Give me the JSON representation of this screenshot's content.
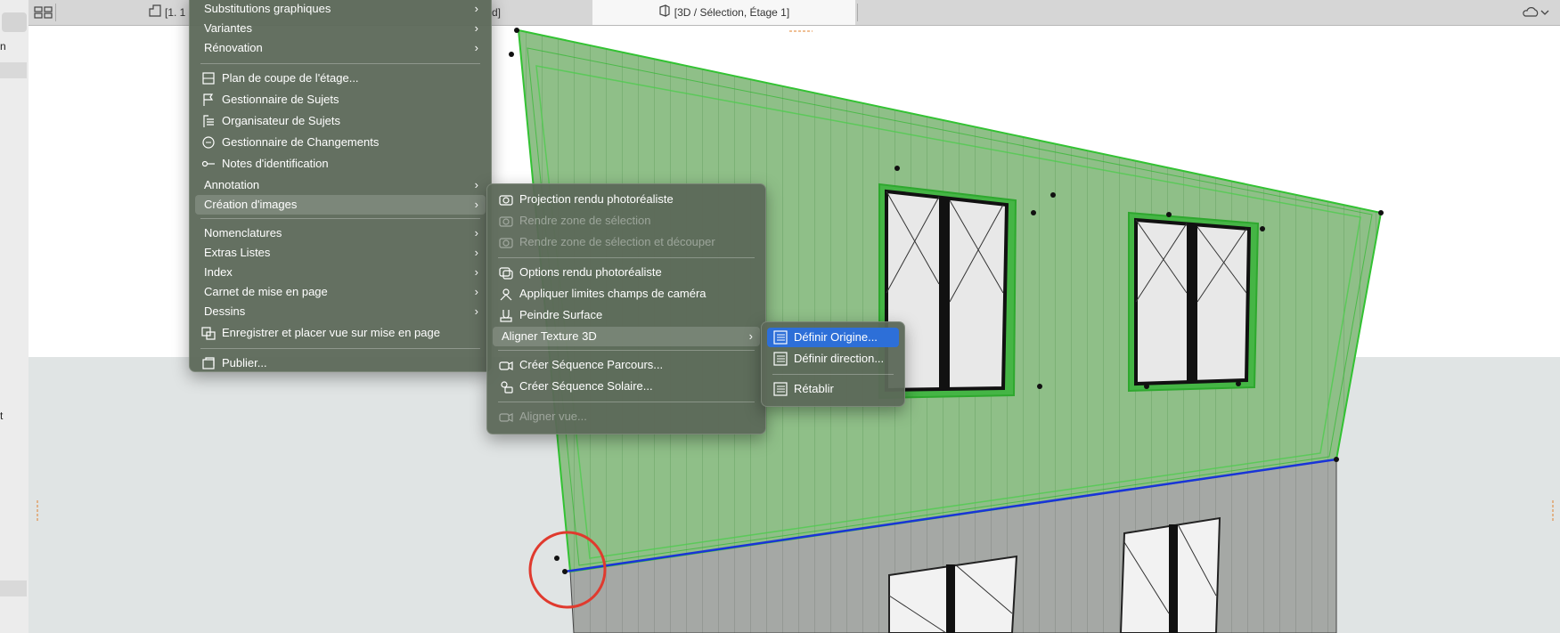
{
  "tabs": {
    "plan_label": "[1. 1",
    "plan_suffix": "d]",
    "active_label": "[3D / Sélection, Étage 1]"
  },
  "left_strip": {
    "items": [
      "n",
      "t"
    ]
  },
  "menu1": {
    "items": [
      {
        "label": "Substitutions graphiques",
        "sub": true
      },
      {
        "label": "Variantes",
        "sub": true
      },
      {
        "label": "Rénovation",
        "sub": true
      },
      {
        "label": "Plan de coupe de l'étage...",
        "icon": "floor-plan-cut-icon"
      },
      {
        "label": "Gestionnaire de Sujets",
        "icon": "flag-icon"
      },
      {
        "label": "Organisateur de Sujets",
        "icon": "organizer-icon"
      },
      {
        "label": "Gestionnaire de Changements",
        "icon": "changes-icon"
      },
      {
        "label": "Notes d'identification",
        "icon": "id-note-icon"
      },
      {
        "label": "Annotation",
        "sub": true
      },
      {
        "label": "Création d'images",
        "sub": true,
        "highlighted": true
      },
      {
        "label": "Nomenclatures",
        "sub": true
      },
      {
        "label": "Extras Listes",
        "sub": true
      },
      {
        "label": "Index",
        "sub": true
      },
      {
        "label": "Carnet de mise en page",
        "sub": true
      },
      {
        "label": "Dessins",
        "sub": true
      },
      {
        "label": "Enregistrer et placer vue sur mise en page",
        "icon": "save-place-icon"
      },
      {
        "label": "Publier...",
        "icon": "publish-icon"
      }
    ]
  },
  "menu2": {
    "items": [
      {
        "label": "Projection rendu photoréaliste",
        "icon": "camera-icon"
      },
      {
        "label": "Rendre zone de sélection",
        "icon": "camera-selection-icon",
        "disabled": true
      },
      {
        "label": "Rendre zone de sélection et découper",
        "icon": "camera-crop-icon",
        "disabled": true
      },
      {
        "label": "Options rendu photoréaliste",
        "icon": "render-options-icon"
      },
      {
        "label": "Appliquer limites champs de caméra",
        "icon": "camera-limits-icon"
      },
      {
        "label": "Peindre Surface",
        "icon": "paint-icon"
      },
      {
        "label": "Aligner Texture 3D",
        "sub": true,
        "highlighted": true
      },
      {
        "label": "Créer Séquence Parcours...",
        "icon": "walkthrough-icon"
      },
      {
        "label": "Créer Séquence Solaire...",
        "icon": "sun-study-icon"
      },
      {
        "label": "Aligner vue...",
        "icon": "align-view-icon",
        "disabled": true
      }
    ]
  },
  "menu3": {
    "items": [
      {
        "label": "Définir Origine...",
        "icon": "texture-origin-icon",
        "selected": true
      },
      {
        "label": "Définir direction...",
        "icon": "texture-direction-icon"
      },
      {
        "label": "Rétablir",
        "icon": "texture-reset-icon"
      }
    ]
  },
  "colors": {
    "menu_bg": "#5c6858",
    "selection_blue": "#2d6fd8",
    "wall_selected": "#7fbf7a",
    "outline_green": "#33c233",
    "edge_blue": "#1a33d9",
    "marker_red": "#e03a2e"
  }
}
